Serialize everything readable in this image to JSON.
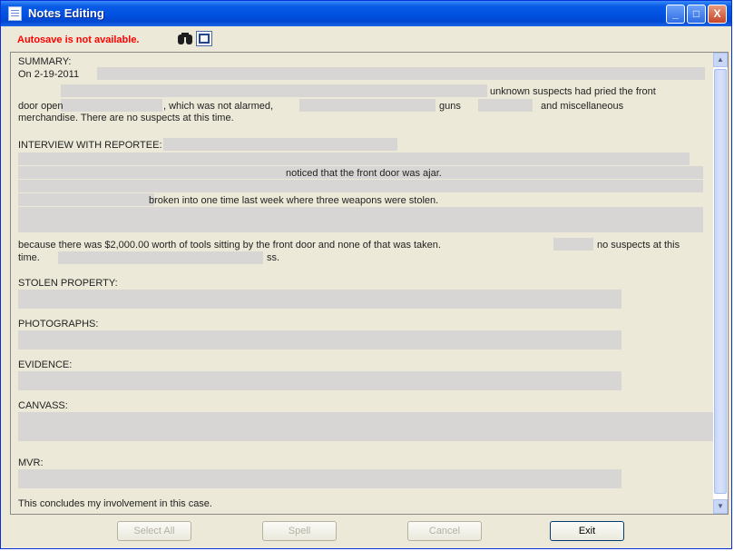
{
  "window": {
    "title": "Notes Editing",
    "buttons": {
      "minimize": "_",
      "maximize": "□",
      "close": "X"
    }
  },
  "toolbar": {
    "autosave_status": "Autosave is not available.",
    "icons": [
      "binoculars-icon",
      "expand-icon"
    ]
  },
  "notes": {
    "lines": [
      "SUMMARY:",
      "On 2-19-2011",
      "unknown suspects had pried the front",
      "door open",
      ", which was not alarmed,",
      "guns",
      "and miscellaneous",
      "merchandise.  There are no suspects at this time.",
      "INTERVIEW WITH REPORTEE:",
      "noticed that the front door was ajar.",
      "broken into one time last week  where three weapons were stolen.",
      "because there was $2,000.00 worth of tools sitting by the front door and none of that was taken.",
      "no suspects at this",
      "time.",
      "ss.",
      "STOLEN PROPERTY:",
      "PHOTOGRAPHS:",
      "EVIDENCE:",
      "CANVASS:",
      "MVR:",
      "This concludes my involvement in this case."
    ]
  },
  "actions": {
    "select_all": "Select All",
    "spell": "Spell",
    "cancel": "Cancel",
    "exit": "Exit"
  },
  "colors": {
    "titlebar": "#0a5ce6",
    "autosave_text": "#ff0000",
    "redaction": "#d7d6d4",
    "window_bg": "#ece9d8"
  }
}
